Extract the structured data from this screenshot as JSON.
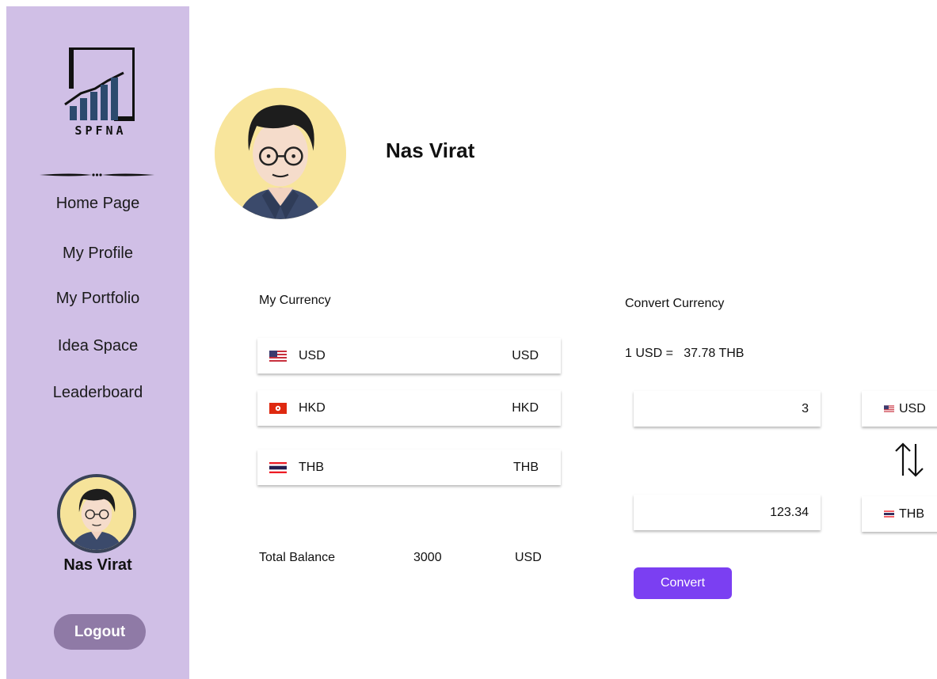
{
  "sidebar": {
    "logo_text": "SPFNA",
    "nav": [
      "Home Page",
      "My Profile",
      "My Portfolio",
      "Idea Space",
      "Leaderboard"
    ],
    "user_name": "Nas Virat",
    "logout_label": "Logout"
  },
  "profile": {
    "name": "Nas Virat"
  },
  "my_currency": {
    "title": "My Currency",
    "rows": [
      {
        "flag": "us-flag-icon",
        "code": "USD",
        "right": "USD"
      },
      {
        "flag": "hk-flag-icon",
        "code": "HKD",
        "right": "HKD"
      },
      {
        "flag": "th-flag-icon",
        "code": "THB",
        "right": "THB"
      }
    ],
    "total_label": "Total Balance",
    "total_value": "3000",
    "total_currency": "USD"
  },
  "convert": {
    "title": "Convert Currency",
    "rate_text": "1 USD =   37.78 THB",
    "from_amount": "3",
    "from_currency": "USD",
    "to_amount": "123.34",
    "to_currency": "THB",
    "button_label": "Convert"
  },
  "colors": {
    "sidebar_bg": "#d0bfe6",
    "logout_bg": "#8f7aa6",
    "accent": "#7b3ff2",
    "avatar_bg": "#f8e59c"
  }
}
